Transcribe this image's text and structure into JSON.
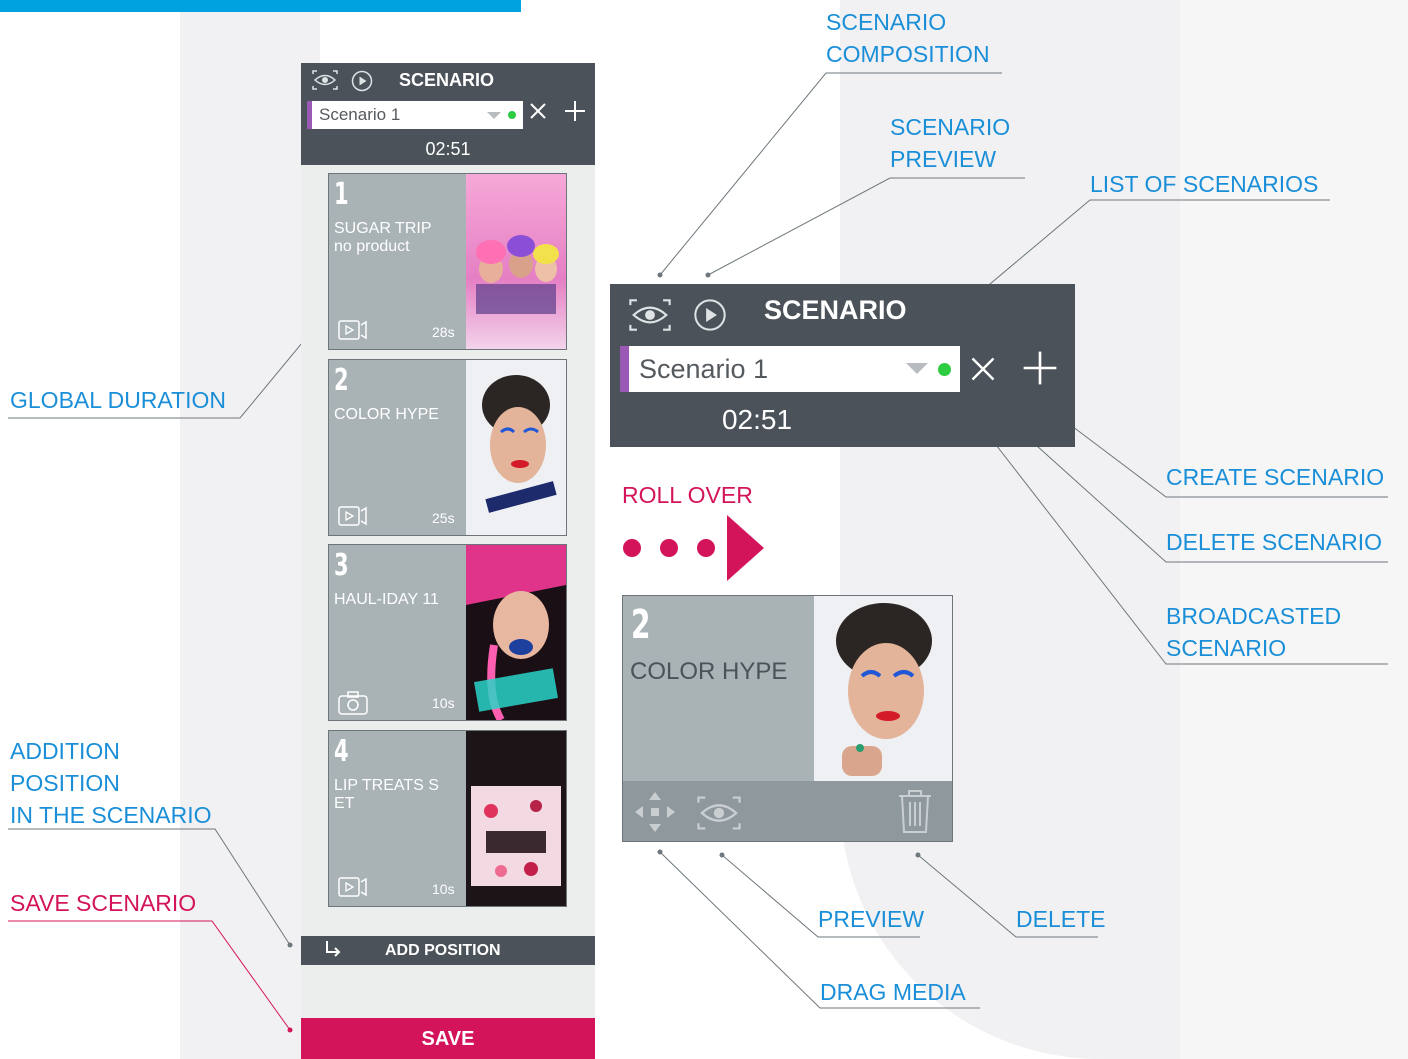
{
  "colors": {
    "accent_blue": "#00a3e0",
    "annotation_blue": "#1a8fd8",
    "annotation_pink": "#d4145a",
    "panel_dark": "#4b5259",
    "card_grey": "#a9b2b5",
    "broadcast_green": "#2ecc40",
    "scenario_purple": "#9b59b6"
  },
  "annotations": {
    "scenario_composition": [
      "SCENARIO",
      "COMPOSITION"
    ],
    "scenario_preview": [
      "SCENARIO",
      "PREVIEW"
    ],
    "list_of_scenarios": "LIST OF SCENARIOS",
    "global_duration": "GLOBAL DURATION",
    "create_scenario": "CREATE SCENARIO",
    "delete_scenario": "DELETE SCENARIO",
    "broadcasted_scenario": [
      "BROADCASTED",
      "SCENARIO"
    ],
    "roll_over": "ROLL OVER",
    "addition_position": [
      "ADDITION",
      "POSITION",
      "IN THE SCENARIO"
    ],
    "save_scenario": "SAVE SCENARIO",
    "preview": "PREVIEW",
    "delete": "DELETE",
    "drag_media": "DRAG MEDIA"
  },
  "panel": {
    "title": "SCENARIO",
    "selected_scenario": "Scenario 1",
    "duration": "02:51",
    "add_position_label": "ADD POSITION",
    "save_label": "SAVE",
    "items": [
      {
        "number": "1",
        "title": "SUGAR TRIP",
        "subtitle": "no product",
        "duration": "28s",
        "media_icon": "video-icon"
      },
      {
        "number": "2",
        "title": "COLOR HYPE",
        "subtitle": "",
        "duration": "25s",
        "media_icon": "video-icon"
      },
      {
        "number": "3",
        "title": "HAUL-IDAY 11",
        "subtitle": "",
        "duration": "10s",
        "media_icon": "camera-icon"
      },
      {
        "number": "4",
        "title": "LIP TREATS S",
        "subtitle": "ET",
        "duration": "10s",
        "media_icon": "video-icon"
      }
    ]
  },
  "rollover_card": {
    "number": "2",
    "title": "COLOR HYPE",
    "actions": [
      "drag-icon",
      "eye-icon",
      "trash-icon"
    ]
  },
  "header_icons": [
    "eye-icon",
    "play-icon",
    "dropdown-arrow-icon",
    "broadcast-dot-icon",
    "close-icon",
    "plus-icon"
  ]
}
